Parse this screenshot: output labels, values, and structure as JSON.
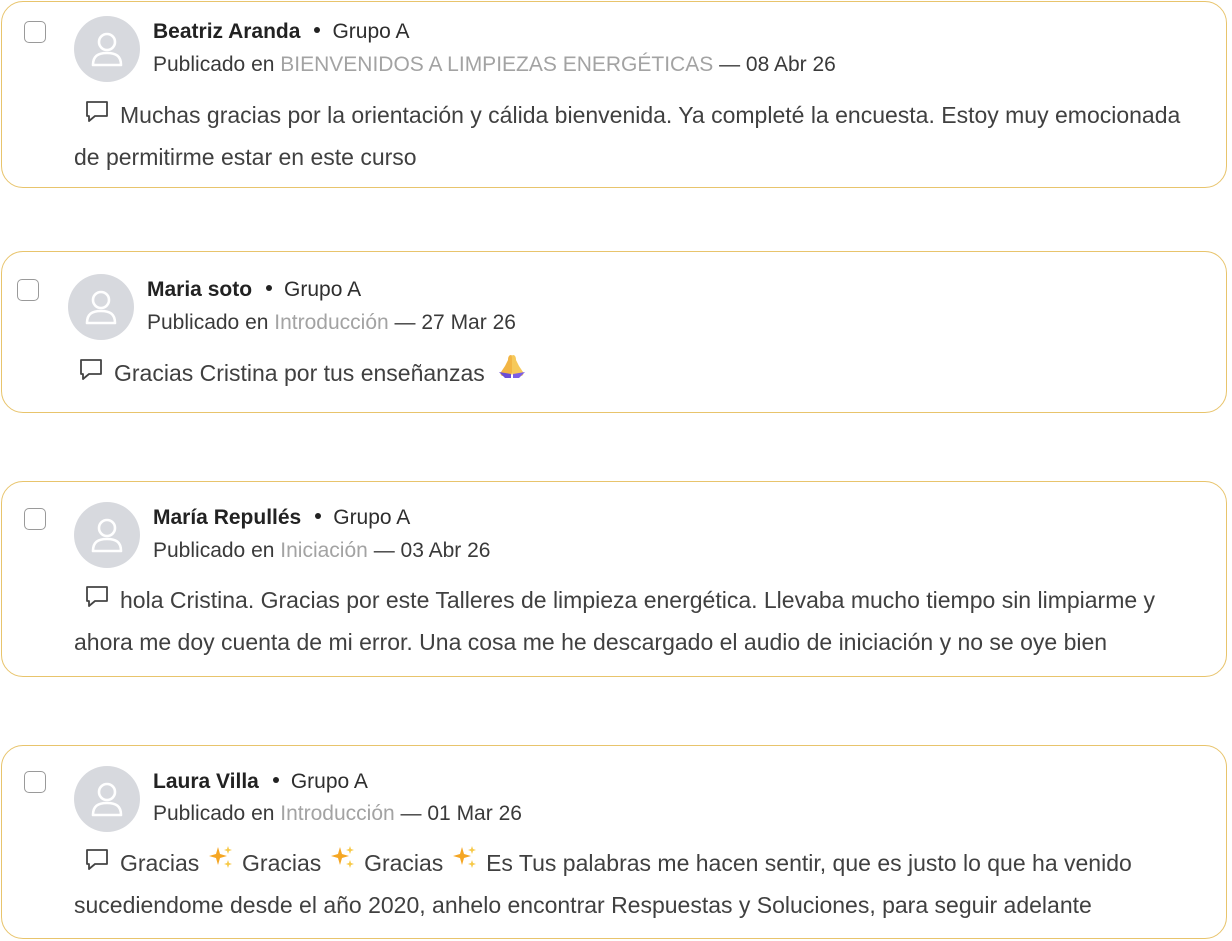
{
  "colors": {
    "card_border": "#e8c46c",
    "avatar_bg": "#d7d9de",
    "link_gray": "#a3a3a3",
    "text": "#404040"
  },
  "comments": [
    {
      "author": "Beatriz Aranda",
      "group": "Grupo A",
      "published_prefix": "Publicado en",
      "lesson": "BIENVENIDOS A LIMPIEZAS ENERGÉTICAS",
      "date_sep": "—",
      "date": "08 Abr 26",
      "text": "Muchas gracias por la orientación y cálida bienvenida. Ya completé la encuesta. Estoy muy emocionada de permitirme estar en este curso"
    },
    {
      "author": "Maria soto",
      "group": "Grupo A",
      "published_prefix": "Publicado en",
      "lesson": "Introducción",
      "date_sep": "—",
      "date": "27 Mar 26",
      "text": "Gracias Cristina por tus enseñanzas",
      "emoji": "praying-hands-icon"
    },
    {
      "author": "María Repullés",
      "group": "Grupo A",
      "published_prefix": "Publicado en",
      "lesson": "Iniciación",
      "date_sep": "—",
      "date": "03 Abr 26",
      "text": "hola Cristina. Gracias por este Talleres de limpieza energética. Llevaba mucho tiempo sin limpiarme y ahora me doy cuenta de mi error. Una cosa me he descargado el audio de iniciación y no se oye bien"
    },
    {
      "author": "Laura Villa",
      "group": "Grupo A",
      "published_prefix": "Publicado en",
      "lesson": "Introducción",
      "date_sep": "—",
      "date": "01 Mar 26",
      "text_parts": [
        "Gracias",
        "Gracias",
        "Gracias",
        "Es Tus palabras me hacen sentir, que es justo lo que ha venido sucediendome desde el año 2020, anhelo encontrar Respuestas y Soluciones, para seguir adelante"
      ],
      "emoji": "sparkles-icon"
    }
  ]
}
